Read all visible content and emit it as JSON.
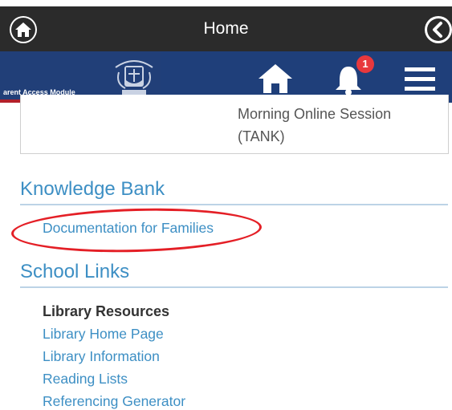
{
  "topbar": {
    "title": "Home",
    "home_icon": "home-circle-icon",
    "back_icon": "back-circle-icon"
  },
  "header": {
    "module_label": "arent Access Module",
    "crest_icon": "school-crest-logo",
    "home_icon": "home-icon",
    "bell_icon": "bell-icon",
    "notification_count": "1",
    "menu_icon": "hamburger-menu-icon"
  },
  "card": {
    "text": "Morning Online Session (TANK)"
  },
  "knowledge_bank": {
    "title": "Knowledge Bank",
    "links": [
      "Documentation for Families"
    ]
  },
  "school_links": {
    "title": "School Links",
    "subheading": "Library Resources",
    "links": [
      "Library Home Page",
      "Library Information",
      "Reading Lists",
      "Referencing Generator"
    ]
  },
  "colors": {
    "topbar": "#2b2b2b",
    "header_blue": "#1f3f7a",
    "link_blue": "#3d8fc4",
    "badge_red": "#e8383d",
    "highlight_red": "#e41f26"
  }
}
